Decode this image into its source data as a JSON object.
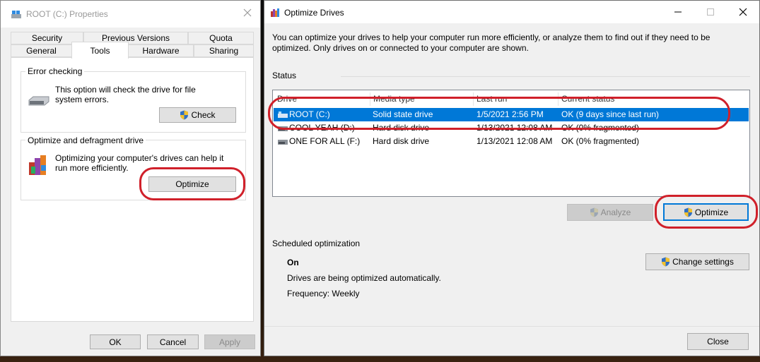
{
  "props": {
    "title": "ROOT (C:) Properties",
    "tabs_row1": [
      "Security",
      "Previous Versions",
      "Quota"
    ],
    "tabs_row2": [
      "General",
      "Tools",
      "Hardware",
      "Sharing"
    ],
    "error_checking": {
      "title": "Error checking",
      "text": "This option will check the drive for file system errors.",
      "check_label": "Check"
    },
    "optimize": {
      "title": "Optimize and defragment drive",
      "text": "Optimizing your computer's drives can help it run more efficiently.",
      "optimize_label": "Optimize"
    },
    "ok_label": "OK",
    "cancel_label": "Cancel",
    "apply_label": "Apply"
  },
  "opt": {
    "title": "Optimize Drives",
    "intro": "You can optimize your drives to help your computer run more efficiently, or analyze them to find out if they need to be optimized. Only drives on or connected to your computer are shown.",
    "status_label": "Status",
    "columns": [
      "Drive",
      "Media type",
      "Last run",
      "Current status"
    ],
    "drives": [
      {
        "name": "ROOT (C:)",
        "media": "Solid state drive",
        "last_run": "1/5/2021 2:56 PM",
        "status": "OK (9 days since last run)"
      },
      {
        "name": "COOL YEAH (D:)",
        "media": "Hard disk drive",
        "last_run": "1/13/2021 12:08 AM",
        "status": "OK (0% fragmented)"
      },
      {
        "name": "ONE FOR ALL (F:)",
        "media": "Hard disk drive",
        "last_run": "1/13/2021 12:08 AM",
        "status": "OK (0% fragmented)"
      }
    ],
    "analyze_label": "Analyze",
    "optimize_label": "Optimize",
    "scheduled_label": "Scheduled optimization",
    "schedule_state": "On",
    "schedule_desc": "Drives are being optimized automatically.",
    "frequency": "Frequency: Weekly",
    "change_settings_label": "Change settings",
    "close_label": "Close"
  },
  "colors": {
    "selection": "#0078d7",
    "highlight_ring": "#d0202a",
    "shield_blue": "#2f6fc4",
    "shield_yellow": "#f2c12e"
  }
}
